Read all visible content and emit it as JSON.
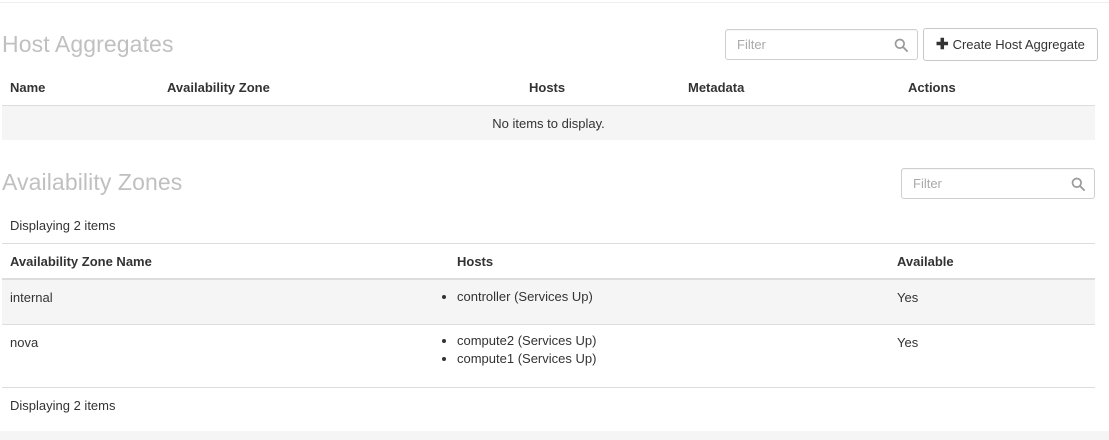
{
  "host_aggregates": {
    "title": "Host Aggregates",
    "filter_placeholder": "Filter",
    "create_button_label": "Create Host Aggregate",
    "columns": [
      "Name",
      "Availability Zone",
      "Hosts",
      "Metadata",
      "Actions"
    ],
    "empty_message": "No items to display."
  },
  "availability_zones": {
    "title": "Availability Zones",
    "filter_placeholder": "Filter",
    "count_label_top": "Displaying 2 items",
    "count_label_bottom": "Displaying 2 items",
    "columns": [
      "Availability Zone Name",
      "Hosts",
      "Available"
    ],
    "rows": [
      {
        "name": "internal",
        "hosts": [
          "controller (Services Up)"
        ],
        "available": "Yes"
      },
      {
        "name": "nova",
        "hosts": [
          "compute2 (Services Up)",
          "compute1 (Services Up)"
        ],
        "available": "Yes"
      }
    ]
  },
  "icons": {
    "filter": "search-icon",
    "create": "plus-icon"
  },
  "colors": {
    "title": "#c0c0c0",
    "stripe": "#f5f5f5",
    "border": "#dddddd"
  }
}
